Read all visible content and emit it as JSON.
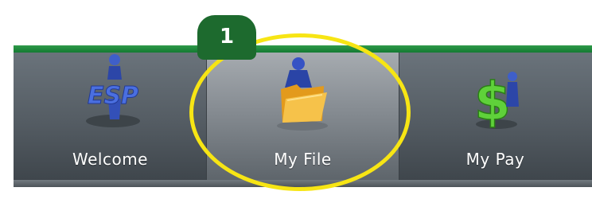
{
  "nav": {
    "tabs": [
      {
        "label": "Welcome",
        "icon": "esp-person-icon",
        "icon_text": "ESP"
      },
      {
        "label": "My File",
        "icon": "folder-person-icon"
      },
      {
        "label": "My Pay",
        "icon": "dollar-person-icon"
      }
    ],
    "selected": "My File"
  },
  "annotation": {
    "step_number": "1",
    "highlight_color": "#f7e514",
    "badge_color": "#1d6a2e"
  },
  "colors": {
    "accent_green": "#1f8a3b",
    "navbar": "#545c63",
    "selected_tab": "#8a9096"
  }
}
